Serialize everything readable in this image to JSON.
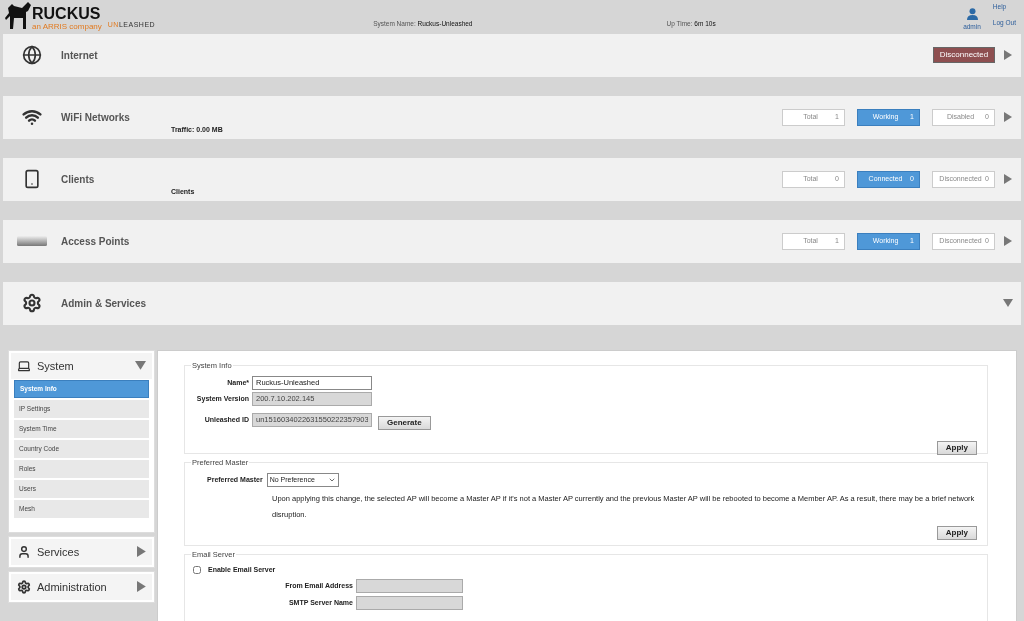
{
  "header": {
    "brand": "RUCKUS",
    "tagline": "an ARRIS company",
    "product_accent": "UN",
    "product_rest": "LEASHED",
    "system_name": {
      "label": "System Name:",
      "value": "Ruckus-Unleashed"
    },
    "up_time": {
      "label": "Up Time:",
      "value": "6m 10s"
    },
    "user": "admin",
    "links": [
      "Help",
      "Log Out"
    ]
  },
  "sections": [
    {
      "kind": "globe",
      "title": "Internet",
      "expanded": false,
      "status": {
        "text": "Disconnected",
        "color": "#8e4f50"
      }
    },
    {
      "kind": "wifi",
      "title": "WiFi Networks",
      "subtitle": "Traffic: 0.00 MB",
      "expanded": false,
      "stats": [
        {
          "label": "Total",
          "value": "1",
          "highlighted": false
        },
        {
          "label": "Working",
          "value": "1",
          "highlighted": true
        },
        {
          "label": "Disabled",
          "value": "0",
          "highlighted": false
        }
      ]
    },
    {
      "kind": "phone",
      "title": "Clients",
      "subtitle": "Clients",
      "expanded": false,
      "stats": [
        {
          "label": "Total",
          "value": "0",
          "highlighted": false
        },
        {
          "label": "Connected",
          "value": "0",
          "highlighted": true
        },
        {
          "label": "Disconnected",
          "value": "0",
          "highlighted": false
        }
      ]
    },
    {
      "kind": "ap",
      "title": "Access Points",
      "expanded": false,
      "stats": [
        {
          "label": "Total",
          "value": "1",
          "highlighted": false
        },
        {
          "label": "Working",
          "value": "1",
          "highlighted": true
        },
        {
          "label": "Disconnected",
          "value": "0",
          "highlighted": false
        }
      ]
    },
    {
      "kind": "gear",
      "title": "Admin & Services",
      "expanded": true
    }
  ],
  "sidebar": [
    {
      "kind": "laptop",
      "title": "System",
      "expanded": true,
      "items": [
        {
          "label": "System Info",
          "selected": true
        },
        {
          "label": "IP Settings",
          "selected": false
        },
        {
          "label": "System Time",
          "selected": false
        },
        {
          "label": "Country Code",
          "selected": false
        },
        {
          "label": "Roles",
          "selected": false
        },
        {
          "label": "Users",
          "selected": false
        },
        {
          "label": "Mesh",
          "selected": false
        }
      ]
    },
    {
      "kind": "person",
      "title": "Services",
      "expanded": false
    },
    {
      "kind": "gear",
      "title": "Administration",
      "expanded": false
    }
  ],
  "system_info": {
    "legend": "System Info",
    "fields": [
      {
        "label": "Name*",
        "value": "Ruckus-Unleashed",
        "disabled": false
      },
      {
        "label": "System Version",
        "value": "200.7.10.202.145",
        "disabled": true
      },
      {
        "label": "Unleashed ID",
        "value": "un1516034022631550222357903",
        "disabled": true,
        "button": "Generate"
      }
    ],
    "apply": "Apply"
  },
  "preferred_master": {
    "legend": "Preferred Master",
    "label": "Preferred Master",
    "value": "No Preference",
    "note": "Upon applying this change, the selected AP will become a Master AP if it's not a Master AP currently and the previous Master AP will be rebooted to become a Member AP. As a result, there may be a brief network disruption.",
    "apply": "Apply"
  },
  "email_server": {
    "legend": "Email Server",
    "enable_label": "Enable Email Server",
    "checked": false,
    "fields": [
      {
        "label": "From Email Address",
        "disabled": true
      },
      {
        "label": "SMTP Server Name",
        "disabled": true
      }
    ]
  }
}
